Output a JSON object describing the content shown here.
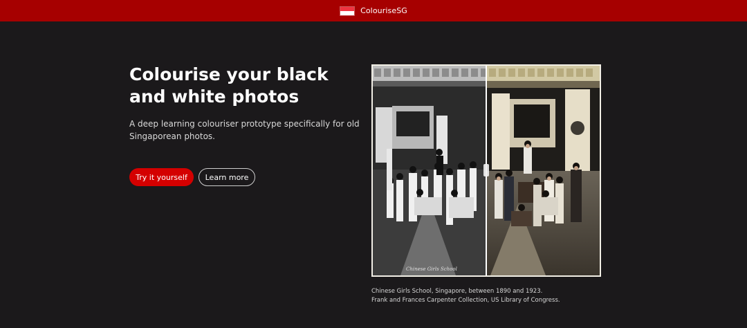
{
  "header": {
    "brand_name": "ColouriseSG",
    "background_color": "#a60000",
    "logo_icon": "singapore-flag-icon"
  },
  "hero": {
    "title": "Colourise your black and white photos",
    "subtitle": "A deep learning colouriser prototype specifically for old Singaporean photos.",
    "primary_button": "Try it yourself",
    "secondary_button": "Learn more",
    "primary_color": "#d40000"
  },
  "compare_image": {
    "left_state": "black-and-white",
    "right_state": "colourised",
    "photo_inscription": "Chinese Girls School"
  },
  "caption": {
    "line1": "Chinese Girls School, Singapore, between 1890 and 1923.",
    "line2": "Frank and Frances Carpenter Collection, US Library of Congress."
  }
}
